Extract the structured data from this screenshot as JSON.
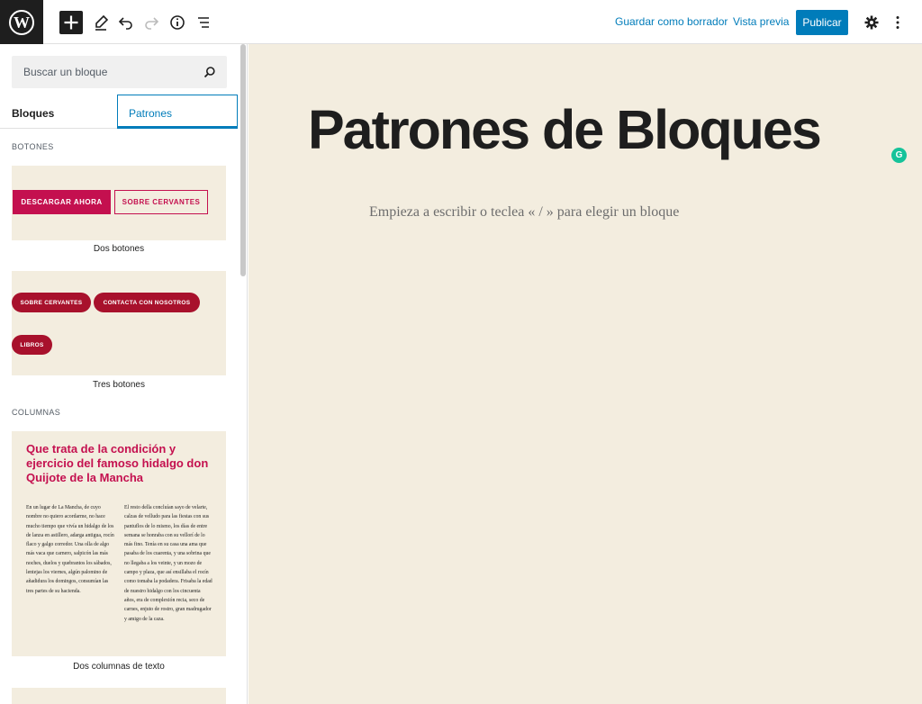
{
  "toolbar": {
    "logo_letter": "W",
    "save_draft": "Guardar como borrador",
    "preview": "Vista previa",
    "publish": "Publicar"
  },
  "sidebar": {
    "search_placeholder": "Buscar un bloque",
    "tabs": [
      "Bloques",
      "Patrones"
    ],
    "active_tab": "Patrones",
    "categories": [
      "BOTONES",
      "COLUMNAS"
    ],
    "patterns": {
      "two_buttons": {
        "label": "Dos botones",
        "buttons": [
          "DESCARGAR AHORA",
          "SOBRE CERVANTES"
        ]
      },
      "three_buttons": {
        "label": "Tres botones",
        "buttons": [
          "SOBRE CERVANTES",
          "CONTACTA CON NOSOTROS",
          "LIBROS"
        ]
      },
      "two_columns": {
        "label": "Dos columnas de texto",
        "title": "Que trata de la condición y ejercicio del famoso hidalgo don Quijote de la Mancha",
        "col1": "En un lugar de La Mancha, de cuyo nombre no quiero acordarme, no hace mucho tiempo que vivía un hidalgo de los de lanza en astillero, adarga antigua, rocín flaco y galgo corredor. Una olla de algo más vaca que carnero, salpicón las más noches, duelos y quebrantos los sábados, lentejas los viernes, algún palomino de añadidura los domingos, consumían las tres partes de su hacienda.",
        "col2": "El resto della concluían sayo de velarte, calzas de velludo para las fiestas con sus pantuflos de lo mismo, los días de entre semana se honraba con su vellorí de lo más fino. Tenía en su casa una ama que pasaba de los cuarenta, y una sobrina que no llegaba a los veinte, y un mozo de campo y plaza, que así ensillaba el rocín como tomaba la podadera. Frisaba la edad de nuestro hidalgo con los cincuenta años, era de complexión recia, seco de carnes, enjuto de rostro, gran madrugador y amigo de la caza."
      }
    }
  },
  "editor": {
    "title": "Patrones de Bloques",
    "placeholder": "Empieza a escribir o teclea « / » para elegir un bloque",
    "grammarly_letter": "G"
  },
  "colors": {
    "accent": "#007cba",
    "canvas": "#f3eddf",
    "button_primary": "#c4104f",
    "pill": "#a8112c"
  }
}
